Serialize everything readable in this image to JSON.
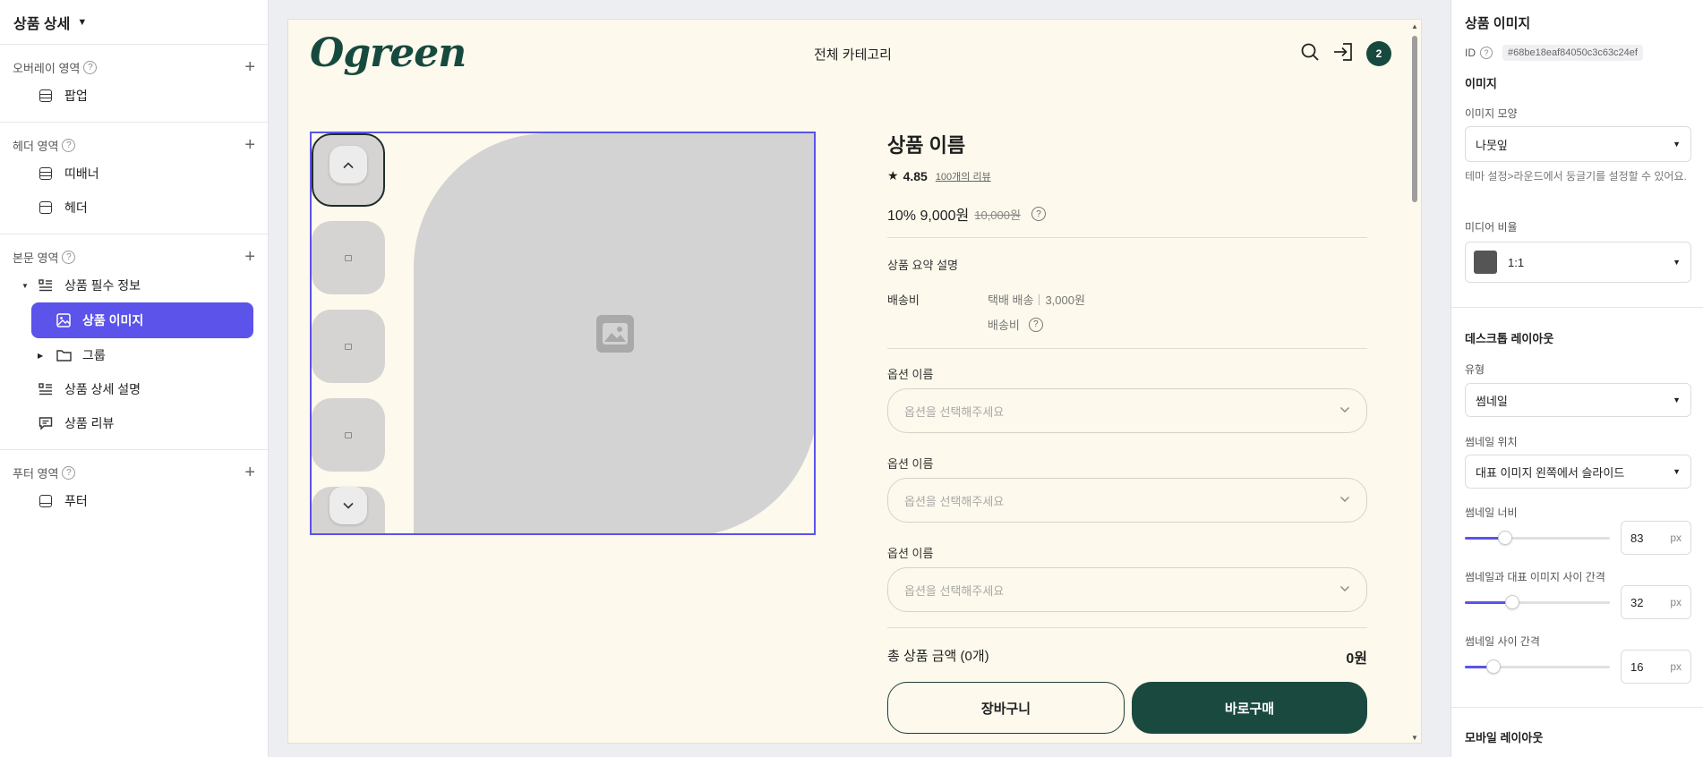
{
  "left": {
    "title": "상품 상세",
    "sections": [
      {
        "label": "오버레이 영역",
        "items": [
          {
            "label": "팝업"
          }
        ]
      },
      {
        "label": "헤더 영역",
        "items": [
          {
            "label": "띠배너"
          },
          {
            "label": "헤더"
          }
        ]
      },
      {
        "label": "본문 영역",
        "items": [
          {
            "label": "상품 필수 정보"
          },
          {
            "label": "상품 이미지"
          },
          {
            "label": "그룹"
          },
          {
            "label": "상품 상세 설명"
          },
          {
            "label": "상품 리뷰"
          }
        ]
      },
      {
        "label": "푸터 영역",
        "items": [
          {
            "label": "푸터"
          }
        ]
      }
    ]
  },
  "canvas": {
    "logo": "Ogreen",
    "nav_center": "전체 카테고리",
    "cart_count": "2",
    "product": {
      "title": "상품 이름",
      "rating": "4.85",
      "reviews": "100개의 리뷰",
      "price": "10% 9,000원",
      "original_price": "10,000원",
      "summary": "상품 요약 설명",
      "shipping_label": "배송비",
      "shipping_method": "택배 배송",
      "shipping_fee": "3,000원",
      "shipping_sub": "배송비",
      "options": [
        {
          "label": "옵션 이름",
          "placeholder": "옵션을 선택해주세요"
        },
        {
          "label": "옵션 이름",
          "placeholder": "옵션을 선택해주세요"
        },
        {
          "label": "옵션 이름",
          "placeholder": "옵션을 선택해주세요"
        }
      ],
      "total_label": "총 상품 금액 (0개)",
      "total_amount": "0원",
      "cart_button": "장바구니",
      "buy_button": "바로구매"
    }
  },
  "right": {
    "title": "상품 이미지",
    "id_label": "ID",
    "id_value": "#68be18eaf84050c3c63c24ef",
    "image_head": "이미지",
    "shape_label": "이미지 모양",
    "shape_value": "나뭇잎",
    "shape_help": "테마 설정>라운드에서 둥글기를 설정할 수 있어요.",
    "ratio_label": "미디어 비율",
    "ratio_value": "1:1",
    "desktop_head": "데스크톱 레이아웃",
    "type_label": "유형",
    "type_value": "썸네일",
    "thumb_pos_label": "썸네일 위치",
    "thumb_pos_value": "대표 이미지 왼쪽에서 슬라이드",
    "thumb_width_label": "썸네일 너비",
    "thumb_width_value": "83",
    "thumb_gap_label": "썸네일과 대표 이미지 사이 간격",
    "thumb_gap_value": "32",
    "thumb_between_label": "썸네일 사이 간격",
    "thumb_between_value": "16",
    "unit": "px",
    "slider_fractions": [
      0.28,
      0.33,
      0.2
    ],
    "mobile_head": "모바일 레이아웃",
    "accent": "#5b53ea"
  }
}
